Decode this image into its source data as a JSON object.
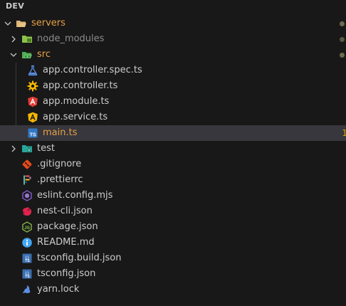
{
  "header": {
    "title": "DEV"
  },
  "tree": {
    "servers": {
      "label": "servers",
      "icon": "folder-open-icon"
    },
    "node_modules": {
      "label": "node_modules",
      "icon": "folder-green-icon"
    },
    "src": {
      "label": "src",
      "icon": "folder-src-open-icon"
    },
    "files_src": [
      {
        "label": "app.controller.spec.ts",
        "icon": "flask-icon"
      },
      {
        "label": "app.controller.ts",
        "icon": "gear-icon"
      },
      {
        "label": "app.module.ts",
        "icon": "angular-icon"
      },
      {
        "label": "app.service.ts",
        "icon": "angular-warning-icon"
      },
      {
        "label": "main.ts",
        "icon": "typescript-icon",
        "badge": "1"
      }
    ],
    "test": {
      "label": "test",
      "icon": "folder-test-icon"
    },
    "files_root": [
      {
        "label": ".gitignore",
        "icon": "git-icon"
      },
      {
        "label": ".prettierrc",
        "icon": "prettier-icon"
      },
      {
        "label": "eslint.config.mjs",
        "icon": "eslint-icon"
      },
      {
        "label": "nest-cli.json",
        "icon": "nest-icon"
      },
      {
        "label": "package.json",
        "icon": "nodejs-icon"
      },
      {
        "label": "README.md",
        "icon": "info-icon"
      },
      {
        "label": "tsconfig.build.json",
        "icon": "tsconfig-icon"
      },
      {
        "label": "tsconfig.json",
        "icon": "tsconfig-icon"
      },
      {
        "label": "yarn.lock",
        "icon": "yarn-icon"
      }
    ]
  },
  "colors": {
    "background": "#181818",
    "selected": "#37373d",
    "text": "#cccccc",
    "folder_label": "#e8a046",
    "warning": "#cca700"
  }
}
